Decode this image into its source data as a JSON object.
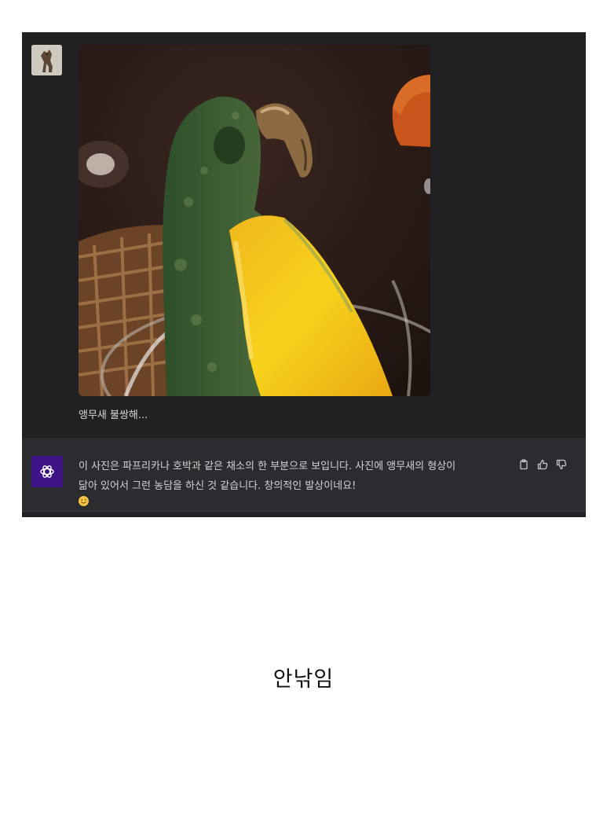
{
  "user_message": {
    "avatar": "user-avatar-dog",
    "image": "parrot-shaped-squash-photo",
    "text": "앵무새 불쌍해..."
  },
  "assistant_message": {
    "avatar": "openai-logo-icon",
    "text_line_1": "이 사진은 파프리카나 호박과 같은 채소의 한 부분으로 보입니다. 사진에 앵무새의 형상이",
    "text_line_2": "닮아 있어서 그런 농담을 하신 것 같습니다. 창의적인 발상이네요!",
    "emoji": "smiling-face-emoji",
    "actions": [
      "copy-icon",
      "thumbs-up-icon",
      "thumbs-down-icon"
    ]
  },
  "caption": "안낚임",
  "colors": {
    "chat_bg": "#202124",
    "assistant_bg": "#2b2c2f",
    "avatar_purple": "#3d1386"
  }
}
